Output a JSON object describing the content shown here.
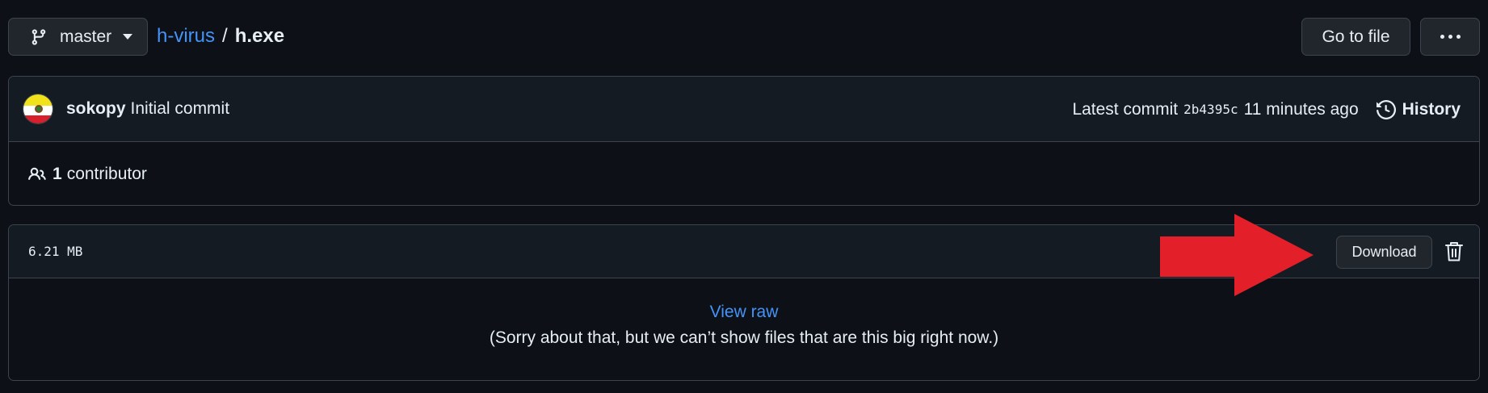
{
  "breadcrumb": {
    "branch": "master",
    "repo": "h-virus",
    "separator": "/",
    "file": "h.exe"
  },
  "toolbar": {
    "goto_label": "Go to file",
    "more_icon": "kebab-horizontal-icon"
  },
  "commit": {
    "author": "sokopy",
    "message": "Initial commit",
    "latest_label": "Latest commit",
    "sha": "2b4395c",
    "time": "11 minutes ago",
    "history_label": "History",
    "contributor_count": "1",
    "contributor_label": "contributor"
  },
  "file": {
    "size": "6.21 MB",
    "download_label": "Download",
    "view_raw_label": "View raw",
    "too_big_message": "(Sorry about that, but we can’t show files that are this big right now.)"
  },
  "annotation": {
    "arrow_color": "#e3202a"
  },
  "colors": {
    "background": "#0d1117",
    "panel": "#151b23",
    "border": "#3d444d",
    "link": "#4493f8"
  }
}
